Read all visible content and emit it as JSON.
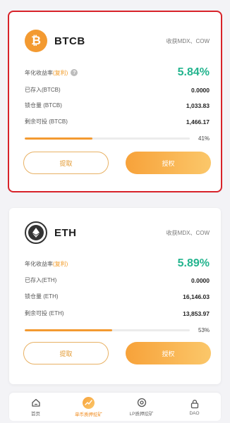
{
  "pools": [
    {
      "coin": "BTCB",
      "icon": "bitcoin-icon",
      "earn": "收获MDX、COW",
      "apy_label": "年化收益率",
      "compound": "(复利)",
      "apy": "5.84%",
      "deposited_label": "已存入(BTCB)",
      "deposited": "0.0000",
      "locked_label": "锁仓量 (BTCB)",
      "locked": "1,033.83",
      "remaining_label": "剩余可投 (BTCB)",
      "remaining": "1,466.17",
      "progress": 41,
      "progress_text": "41%",
      "withdraw": "提取",
      "authorize": "授权"
    },
    {
      "coin": "ETH",
      "icon": "ethereum-icon",
      "earn": "收获MDX、COW",
      "apy_label": "年化收益率",
      "compound": "(复利)",
      "apy": "5.89%",
      "deposited_label": "已存入(ETH)",
      "deposited": "0.0000",
      "locked_label": "锁仓量 (ETH)",
      "locked": "16,146.03",
      "remaining_label": "剩余可投 (ETH)",
      "remaining": "13,853.97",
      "progress": 53,
      "progress_text": "53%",
      "withdraw": "提取",
      "authorize": "授权"
    }
  ],
  "tabbar": {
    "home": "首页",
    "single": "单币质押挖矿",
    "lp": "LP质押挖矿",
    "dao": "DAO"
  },
  "colors": {
    "accent": "#f39a31",
    "apy": "#23b48e",
    "highlight_border": "#d8232a"
  }
}
